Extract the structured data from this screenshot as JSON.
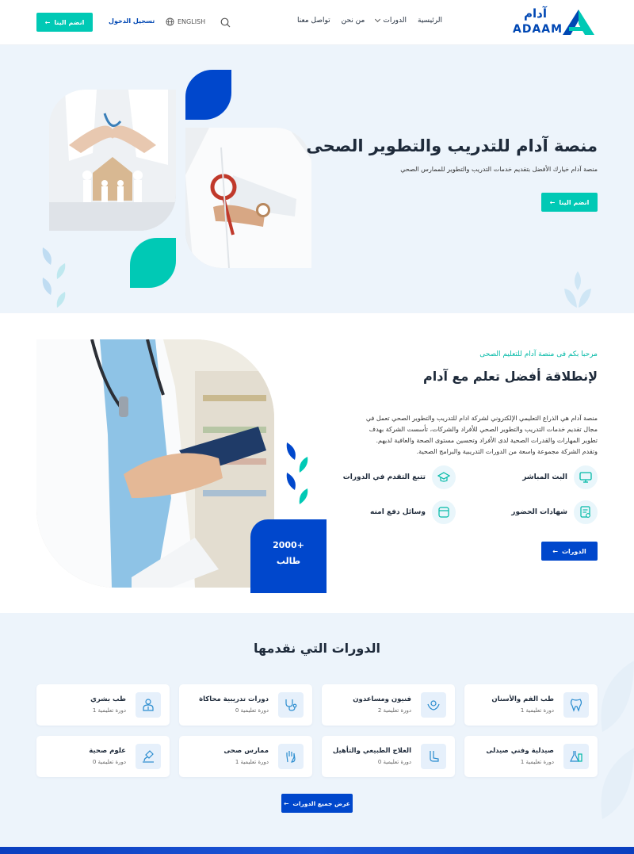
{
  "nav": {
    "logo_ar": "آدام",
    "logo_en": "ADAAM",
    "menu": [
      "الرئيسية",
      "الدورات",
      "من نحن",
      "تواصل معنا"
    ],
    "lang": "ENGLISH",
    "login": "تسجيل الدخول",
    "join": "انضم الينا"
  },
  "hero": {
    "title": "منصة آدام للتدريب والتطوير الصحى",
    "subtitle": "منصة آدام خيارك الأفضل بتقديم خدمات التدريب والتطوير للممارس الصحي",
    "join": "انضم الينا"
  },
  "about": {
    "welcome": "مرحبا بكم فى منصة آدام للتعليم الصحى",
    "title": "لإنطلاقة أفضل تعلم مع آدام",
    "lines": [
      "منصة آدام هي الذراع التعليمي الإلكتروني لشركة ادام للتدريب والتطوير الصحي تعمل في",
      "مجال تقديم خدمات التدريب والتطوير الصحي للأفراد والشركات، تأسست الشركة بهدف",
      "تطوير المهارات والقدرات الصحية لدى الأفراد وتحسين مستوى الصحة والعافية لديهم.",
      "وتقدم الشركة مجموعة واسعة من الدورات التدريبية والبرامج الصحية."
    ],
    "features": [
      "البث المباشر",
      "تتبع التقدم في الدورات",
      "شهادات الحضور",
      "وسائل دفع امنه"
    ],
    "courses_btn": "الدورات",
    "stat_value": "+2000",
    "stat_label": "طالب"
  },
  "courses": {
    "title": "الدورات التي نقدمها",
    "cards": [
      {
        "name": "طب الفم والأسنان",
        "count": "دورة تعليمية 1",
        "icon": "tooth-icon"
      },
      {
        "name": "فنيون ومساعدون",
        "count": "دورة تعليمية 2",
        "icon": "hands-care-icon"
      },
      {
        "name": "دورات تدريبية محاكاة",
        "count": "دورة تعليمية 0",
        "icon": "stethoscope-icon"
      },
      {
        "name": "طب بشري",
        "count": "دورة تعليمية 1",
        "icon": "doctor-icon"
      },
      {
        "name": "صيدلية وفني صيدلى",
        "count": "دورة تعليمية 1",
        "icon": "flask-icon"
      },
      {
        "name": "العلاج الطبيعي والتأهيل",
        "count": "دورة تعليمية 0",
        "icon": "foot-icon"
      },
      {
        "name": "ممارس صحى",
        "count": "دورة تعليمية 1",
        "icon": "hand-icon"
      },
      {
        "name": "علوم صحية",
        "count": "دورة تعليمية 0",
        "icon": "microscope-icon"
      }
    ],
    "view_all": "عرض جميع الدورات"
  },
  "colors": {
    "primary": "#0047cc",
    "accent": "#00c9b5",
    "bg": "#edf4fb"
  }
}
